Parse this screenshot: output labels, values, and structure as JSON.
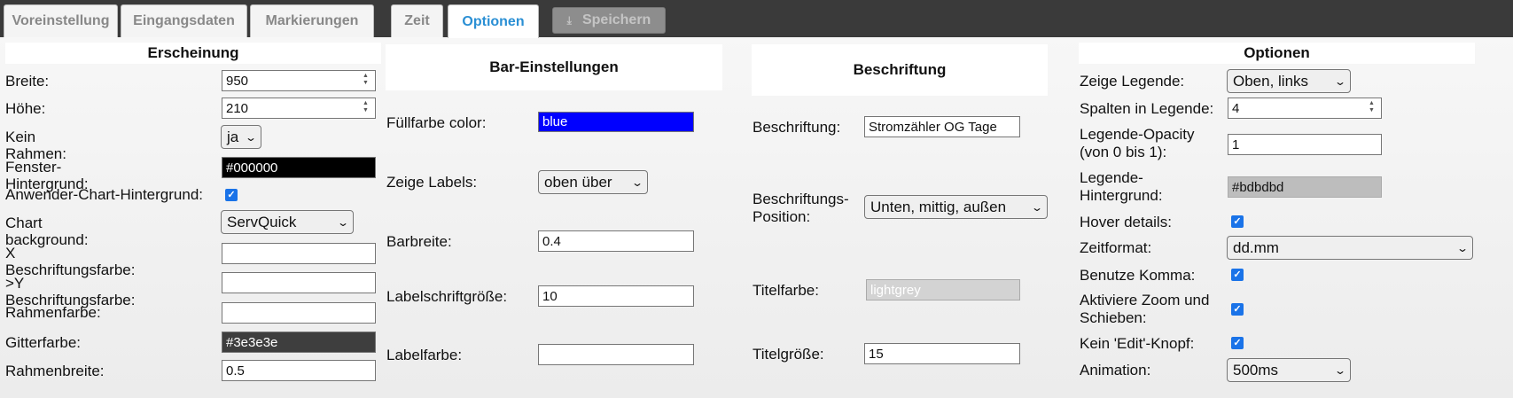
{
  "tabs": [
    {
      "label": "Voreinstellung"
    },
    {
      "label": "Eingangsdaten"
    },
    {
      "label": "Markierungen"
    },
    {
      "label": "Zeit"
    },
    {
      "label": "Optionen"
    }
  ],
  "save_button": {
    "label": "Speichern",
    "icon": "download-icon"
  },
  "appearance": {
    "title": "Erscheinung",
    "breite": {
      "label": "Breite:",
      "value": "950"
    },
    "hoehe": {
      "label": "Höhe:",
      "value": "210"
    },
    "kein_rahmen": {
      "label": "Kein Rahmen:",
      "value": "ja"
    },
    "fenster_hintergrund": {
      "label": "Fenster-Hintergrund:",
      "value": "#000000"
    },
    "anwender_hintergrund": {
      "label": "Anwender-Chart-Hintergrund:",
      "checked": true
    },
    "chart_background": {
      "label": "Chart background:",
      "value": "ServQuick"
    },
    "x_farbe": {
      "label": "X Beschriftungsfarbe:",
      "value": ""
    },
    "y_farbe": {
      "label": ">Y Beschriftungsfarbe:",
      "value": ""
    },
    "rahmenfarbe": {
      "label": "Rahmenfarbe:",
      "value": ""
    },
    "gitterfarbe": {
      "label": "Gitterfarbe:",
      "value": "#3e3e3e"
    },
    "rahmenbreite": {
      "label": "Rahmenbreite:",
      "value": "0.5"
    }
  },
  "bar": {
    "title": "Bar-Einstellungen",
    "fuellfarbe": {
      "label": "Füllfarbe color:",
      "value": "blue"
    },
    "zeige_labels": {
      "label": "Zeige Labels:",
      "value": "oben über"
    },
    "barbreite": {
      "label": "Barbreite:",
      "value": "0.4"
    },
    "labelschrift": {
      "label": "Labelschriftgröße:",
      "value": "10"
    },
    "labelfarbe": {
      "label": "Labelfarbe:",
      "value": ""
    }
  },
  "caption": {
    "title": "Beschriftung",
    "beschriftung": {
      "label": "Beschriftung:",
      "value": "Stromzähler OG Tage"
    },
    "position": {
      "label_line1": "Beschriftungs-",
      "label_line2": "Position:",
      "value": "Unten, mittig, außen"
    },
    "titelfarbe": {
      "label": "Titelfarbe:",
      "value": "lightgrey"
    },
    "titelgroesse": {
      "label": "Titelgröße:",
      "value": "15"
    }
  },
  "options": {
    "title": "Optionen",
    "zeige_legende": {
      "label": "Zeige Legende:",
      "value": "Oben, links"
    },
    "spalten": {
      "label": "Spalten in Legende:",
      "value": "4"
    },
    "opacity": {
      "label_line1": "Legende-Opacity",
      "label_line2": "(von 0 bis 1):",
      "value": "1"
    },
    "legende_hintergrund": {
      "label_line1": "Legende-",
      "label_line2": "Hintergrund:",
      "value": "#bdbdbd"
    },
    "hover": {
      "label": "Hover details:",
      "checked": true
    },
    "zeitformat": {
      "label": "Zeitformat:",
      "value": "dd.mm"
    },
    "komma": {
      "label": "Benutze Komma:",
      "checked": true
    },
    "zoom": {
      "label_line1": "Aktiviere Zoom und",
      "label_line2": "Schieben:",
      "checked": true
    },
    "edit": {
      "label": "Kein 'Edit'-Knopf:",
      "checked": true
    },
    "animation": {
      "label": "Animation:",
      "value": "500ms"
    }
  },
  "colors": {
    "accent": "#2a8fd4",
    "checkbox": "#1a73e8",
    "fill_blue": "#0000ff",
    "black": "#000000",
    "grid": "#3e3e3e",
    "legend_bg": "#bdbdbd",
    "lightgrey": "#d3d3d3"
  }
}
